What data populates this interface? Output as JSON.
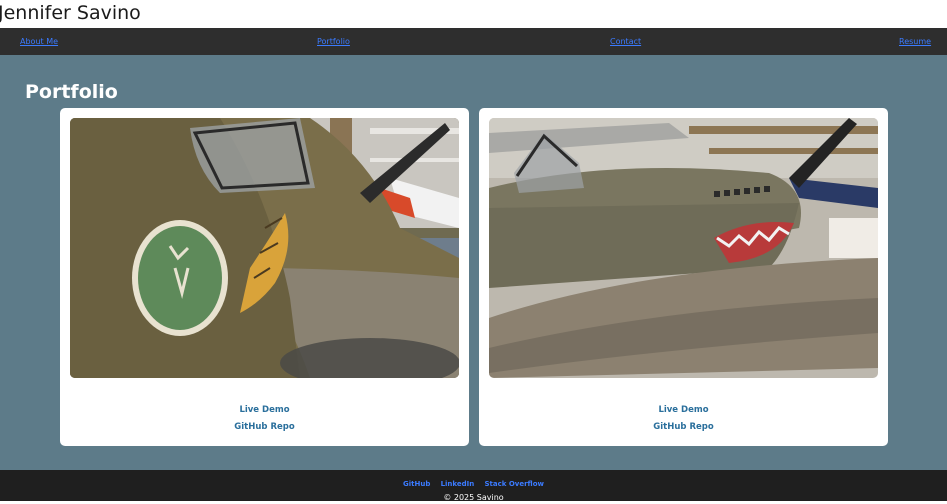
{
  "header": {
    "title": "Jennifer Savino"
  },
  "nav": {
    "items": [
      "About Me",
      "Portfolio",
      "Contact",
      "Resume"
    ]
  },
  "main": {
    "section_title": "Portfolio",
    "projects": [
      {
        "image_icon": "warplane-nose-art-photo",
        "live_demo": "Live Demo",
        "repo": "GitHub Repo"
      },
      {
        "image_icon": "sharkmouth-warplane-photo",
        "live_demo": "Live Demo",
        "repo": "GitHub Repo"
      }
    ]
  },
  "footer": {
    "links": [
      "GitHub",
      "LinkedIn",
      "Stack Overflow"
    ],
    "copyright": "© 2025 Savino"
  },
  "colors": {
    "page_bg": "#5d7b89",
    "nav_bg": "#2e2e2e",
    "link": "#3b7bff",
    "card_link": "#2a6f9c",
    "footer_bg": "#1f1f1f"
  }
}
